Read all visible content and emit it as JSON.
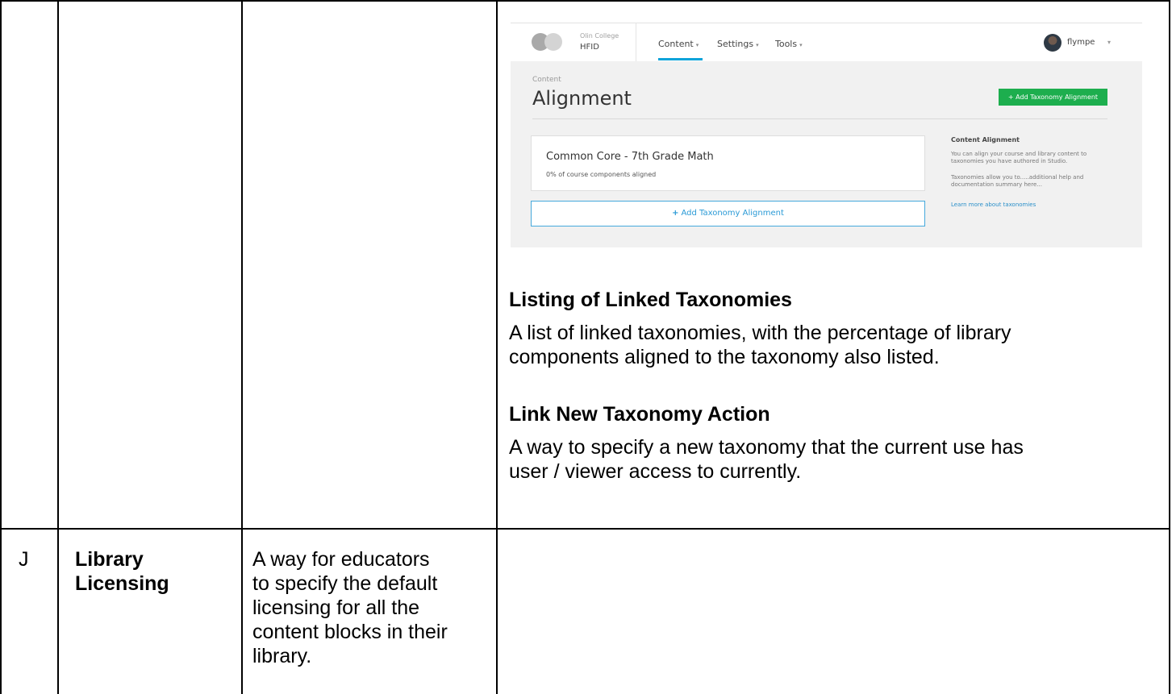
{
  "screenshot": {
    "org": {
      "name": "Olin College",
      "code": "HFID"
    },
    "nav": [
      {
        "label": "Content",
        "caret": "▾"
      },
      {
        "label": "Settings",
        "caret": "▾"
      },
      {
        "label": "Tools",
        "caret": "▾"
      }
    ],
    "user": {
      "name": "flympe",
      "caret": "▾"
    },
    "breadcrumb": "Content",
    "page_title": "Alignment",
    "add_button": "+ Add Taxonomy Alignment",
    "card": {
      "title": "Common Core - 7th Grade Math",
      "subtitle": "0% of course components aligned"
    },
    "add_outline_button": {
      "plus": "+",
      "label": "Add Taxonomy Alignment"
    },
    "sidebar": {
      "title": "Content Alignment",
      "p1": "You can align your course and library content to taxonomies you have authored in Studio.",
      "p2": "Taxonomies allow you to.....additional help and documentation summary here...",
      "link": "Learn more about taxonomies"
    }
  },
  "sections": [
    {
      "heading": "Listing of Linked Taxonomies",
      "lines": [
        "A list of linked taxonomies, with the percentage of library",
        "components aligned to the taxonomy also listed."
      ]
    },
    {
      "heading": "Link New Taxonomy Action",
      "lines": [
        "A way to specify a new taxonomy that the current use has",
        "user / viewer access to currently."
      ]
    }
  ],
  "row_j": {
    "id": "J",
    "title_lines": [
      "Library",
      "Licensing"
    ],
    "desc_lines": [
      "A way for educators",
      "to specify the default",
      "licensing for all the",
      "content blocks in their",
      "library."
    ]
  }
}
